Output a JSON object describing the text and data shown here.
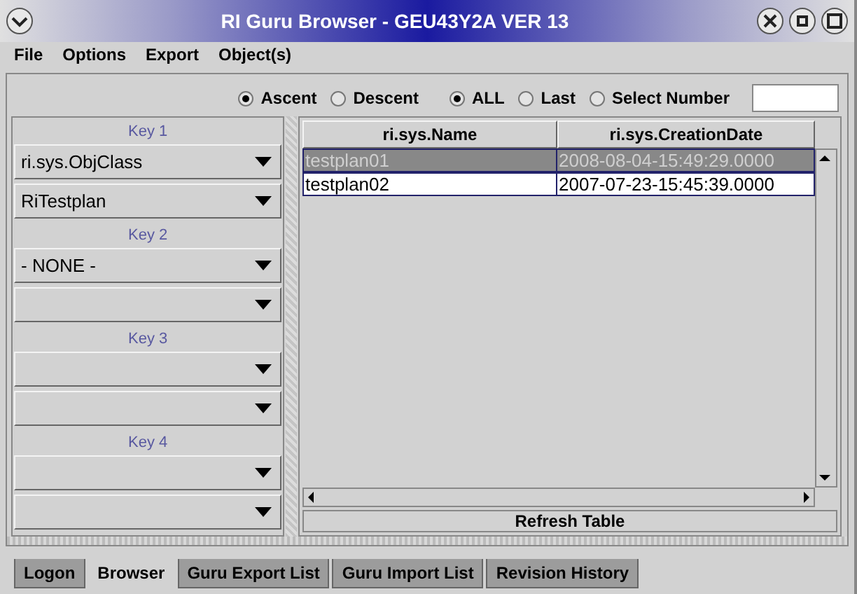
{
  "window": {
    "title": "RI Guru Browser - GEU43Y2A  VER 13"
  },
  "menu": [
    "File",
    "Options",
    "Export",
    "Object(s)"
  ],
  "sort_order": [
    {
      "label": "Ascent",
      "selected": true
    },
    {
      "label": "Descent",
      "selected": false
    }
  ],
  "range": [
    {
      "label": "ALL",
      "selected": true
    },
    {
      "label": "Last",
      "selected": false
    },
    {
      "label": "Select Number",
      "selected": false
    }
  ],
  "keys": [
    {
      "label": "Key 1",
      "dropdowns": [
        {
          "kind": "filled",
          "value": "ri.sys.ObjClass"
        },
        {
          "kind": "filled",
          "value": "RiTestplan"
        }
      ]
    },
    {
      "label": "Key 2",
      "dropdowns": [
        {
          "kind": "filled",
          "value": "- NONE -"
        },
        {
          "kind": "empty"
        }
      ]
    },
    {
      "label": "Key 3",
      "dropdowns": [
        {
          "kind": "empty"
        },
        {
          "kind": "empty"
        }
      ]
    },
    {
      "label": "Key 4",
      "dropdowns": [
        {
          "kind": "empty"
        },
        {
          "kind": "empty"
        }
      ]
    }
  ],
  "table": {
    "columns": [
      "ri.sys.Name",
      "ri.sys.CreationDate"
    ],
    "rows": [
      {
        "cells": [
          "testplan01",
          "2008-08-04-15:49:29.0000"
        ],
        "selected": true
      },
      {
        "cells": [
          "testplan02",
          "2007-07-23-15:45:39.0000"
        ],
        "selected": false
      }
    ]
  },
  "refresh_button": "Refresh Table",
  "tabs": [
    {
      "label": "Logon",
      "selected": false
    },
    {
      "label": "Browser",
      "selected": true
    },
    {
      "label": "Guru Export List",
      "selected": false
    },
    {
      "label": "Guru Import List",
      "selected": false
    },
    {
      "label": "Revision History",
      "selected": false
    }
  ]
}
